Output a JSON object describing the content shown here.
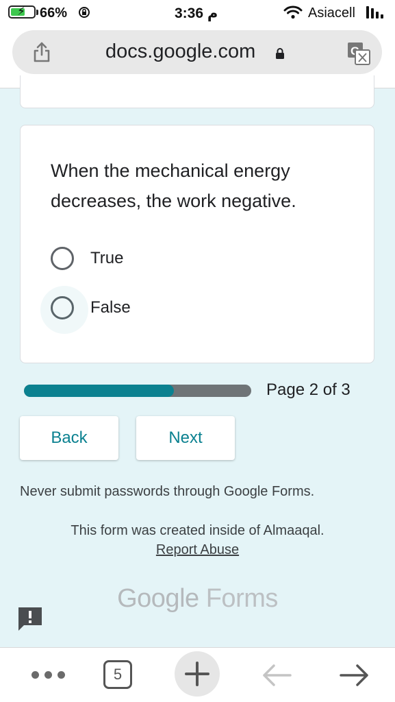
{
  "status_bar": {
    "battery_percent": "66%",
    "battery_level": 0.66,
    "time": "3:36 م",
    "carrier": "Asiacell",
    "icons": [
      "battery-charging-icon",
      "rotation-lock-icon",
      "wifi-icon",
      "signal-icon"
    ]
  },
  "browser": {
    "url": "docs.google.com",
    "icons": [
      "share-icon",
      "lock-icon",
      "translate-icon"
    ]
  },
  "question": {
    "text": "When the mechanical energy decreases, the work negative.",
    "options": [
      {
        "label": "True",
        "selected": false
      },
      {
        "label": "False",
        "selected": false
      }
    ]
  },
  "progress": {
    "label": "Page 2 of 3",
    "fraction": 0.66
  },
  "buttons": {
    "back": "Back",
    "next": "Next"
  },
  "footer": {
    "warning": "Never submit passwords through Google Forms.",
    "created": "This form was created inside of Almaaqal.",
    "report": "Report Abuse",
    "brand_google": "Google",
    "brand_forms": "Forms"
  },
  "toolbar": {
    "tab_count": "5",
    "icons": [
      "more-icon",
      "tabs-icon",
      "new-tab-icon",
      "back-arrow-icon",
      "forward-arrow-icon"
    ]
  },
  "colors": {
    "accent": "#0b8190",
    "background": "#e4f4f7",
    "track": "#6f7477"
  }
}
